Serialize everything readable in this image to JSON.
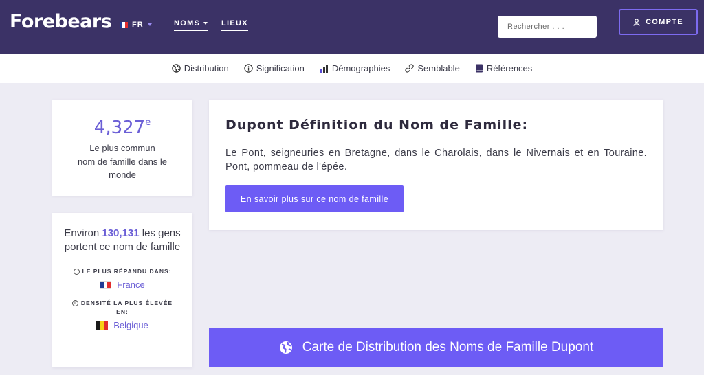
{
  "header": {
    "logo": "Forebears",
    "lang": "FR",
    "nav": [
      {
        "label": "NOMS"
      },
      {
        "label": "LIEUX"
      }
    ],
    "search_placeholder": "Rechercher . . .",
    "account_label": "COMPTE"
  },
  "subnav": [
    {
      "label": "Distribution",
      "icon": "globe-icon"
    },
    {
      "label": "Signification",
      "icon": "info-icon"
    },
    {
      "label": "Démographies",
      "icon": "bar-chart-icon"
    },
    {
      "label": "Semblable",
      "icon": "link-icon"
    },
    {
      "label": "Références",
      "icon": "book-icon"
    }
  ],
  "rank_card": {
    "rank": "4,327",
    "suffix": "e",
    "desc_line1": "Le plus commun",
    "desc_line2": "nom de famille dans le monde"
  },
  "people_card": {
    "prefix": "Environ ",
    "count": "130,131",
    "suffix": " les gens portent ce nom de famille",
    "most_common_label": "LE PLUS RÉPANDU DANS:",
    "most_common_country": "France",
    "density_label_line1": "DENSITÉ LA PLUS ÉLEVÉE",
    "density_label_line2": "EN:",
    "density_country": "Belgique"
  },
  "definition_card": {
    "title": "Dupont Définition du Nom de Famille:",
    "text": "Le Pont, seigneuries en Bretagne, dans le Charolais, dans le Nivernais et en Touraine. Pont, pommeau de l'épée.",
    "button_label": "En savoir plus sur ce nom de famille"
  },
  "map_banner": {
    "label": "Carte de Distribution des Noms de Famille Dupont"
  },
  "colors": {
    "header_bg": "#3b3266",
    "accent": "#6d5cf5",
    "page_bg": "#edecf4"
  }
}
